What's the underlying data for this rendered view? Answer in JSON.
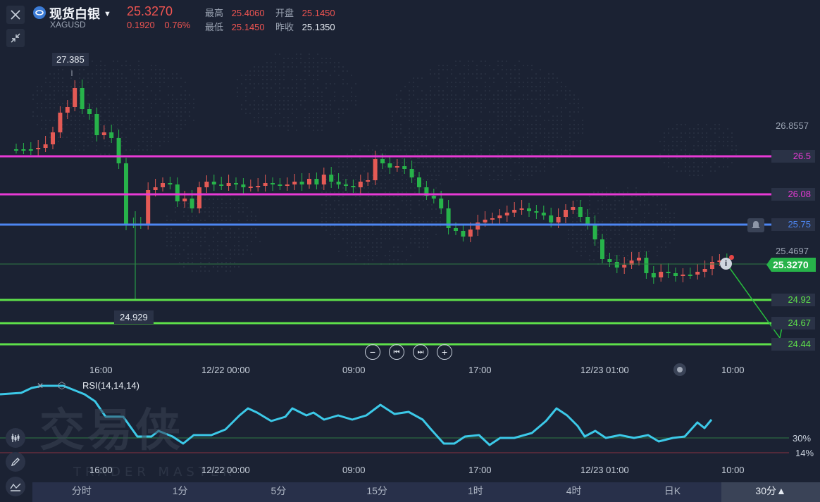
{
  "header": {
    "symbol_name": "现货白银",
    "symbol_code": "XAGUSD",
    "last_price": "25.3270",
    "change": "0.1920",
    "change_pct": "0.76%",
    "high_label": "最高",
    "high_value": "25.4060",
    "open_label": "开盘",
    "open_value": "25.1450",
    "low_label": "最低",
    "low_value": "25.1450",
    "prev_close_label": "昨收",
    "prev_close_value": "25.1350"
  },
  "chart": {
    "price_axis": [
      "26.8557",
      "25.4697"
    ],
    "levels": [
      {
        "label": "26.5",
        "color": "#e83ad6"
      },
      {
        "label": "26.08",
        "color": "#e83ad6"
      },
      {
        "label": "25.75",
        "color": "#4d86f2"
      },
      {
        "label": "24.92",
        "color": "#5ee04a"
      },
      {
        "label": "24.67",
        "color": "#5ee04a"
      },
      {
        "label": "24.44",
        "color": "#5ee04a"
      }
    ],
    "current_price_label": "25.3270",
    "max_label": "27.385",
    "min_label": "24.929",
    "time_axis": [
      "16:00",
      "12/22 00:00",
      "09:00",
      "17:00",
      "12/23 01:00",
      "10:00"
    ],
    "up_color": "#e45a55",
    "down_color": "#27b34a"
  },
  "rsi": {
    "title": "RSI(14,14,14)",
    "levels": [
      "30%",
      "14%"
    ],
    "time_axis": [
      "16:00",
      "12/22 00:00",
      "09:00",
      "17:00",
      "12/23 01:00",
      "10:00"
    ],
    "color": "#3cc9e8"
  },
  "watermark": {
    "text": "交易侠",
    "sub": "TRADER MASTER"
  },
  "timeframes": [
    {
      "label": "分时",
      "active": false
    },
    {
      "label": "1分",
      "active": false
    },
    {
      "label": "5分",
      "active": false
    },
    {
      "label": "15分",
      "active": false
    },
    {
      "label": "1时",
      "active": false
    },
    {
      "label": "4时",
      "active": false
    },
    {
      "label": "日K",
      "active": false
    },
    {
      "label": "30分▲",
      "active": true
    }
  ],
  "icons": {
    "close": "close-icon",
    "collapse": "collapse-icon",
    "alert": "bell-icon",
    "info": "info-icon",
    "indicator": "candles-icon",
    "draw": "pencil-icon",
    "rsi": "wave-icon"
  }
}
